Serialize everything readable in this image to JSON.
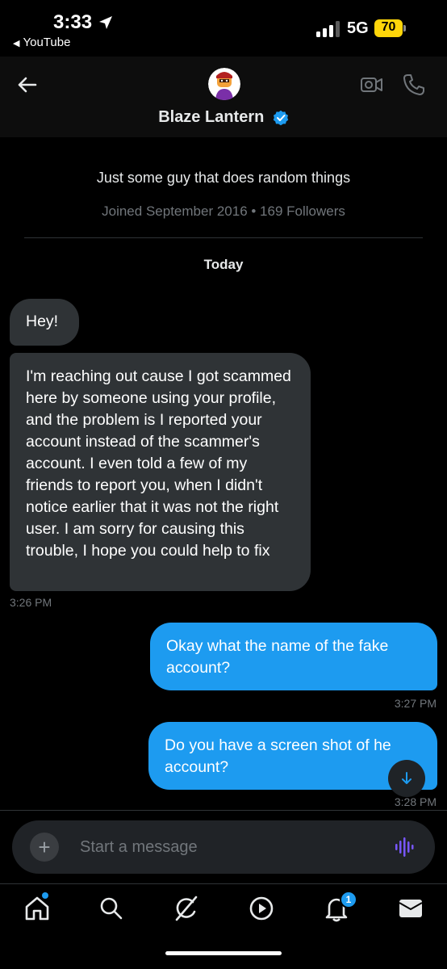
{
  "status_bar": {
    "time": "3:33",
    "back_app": "YouTube",
    "network": "5G",
    "battery": "70"
  },
  "header": {
    "name": "Blaze Lantern"
  },
  "profile": {
    "bio": "Just some guy that does random things",
    "meta": "Joined September 2016 • 169 Followers"
  },
  "day_label": "Today",
  "messages": [
    {
      "text": "Hey!"
    },
    {
      "text": "I'm reaching out cause I got scammed here by someone using your profile, and the problem is I reported your account instead of the scammer's account. I even told a few of my friends to report you, when I didn't notice earlier that it was not the right user. I am sorry for causing this trouble, I hope you could help to fix",
      "time": "3:26 PM"
    },
    {
      "text": "Okay what the name of the fake account?",
      "time": "3:27 PM"
    },
    {
      "text": "Do you have a screen shot of he account?",
      "time": "3:28 PM"
    }
  ],
  "composer": {
    "placeholder": "Start a message"
  },
  "nav": {
    "notifications_badge": "1"
  },
  "colors": {
    "accent": "#1d9bf0",
    "incoming_bubble": "#2f3336",
    "battery": "#ffd60a",
    "voice_icon": "#7856ff"
  },
  "icons": [
    "back-arrow-icon",
    "video-call-icon",
    "phone-icon",
    "verified-badge-icon",
    "plus-icon",
    "voice-wave-icon",
    "home-icon",
    "search-icon",
    "grok-icon",
    "play-icon",
    "bell-icon",
    "mail-icon",
    "arrow-down-icon"
  ]
}
